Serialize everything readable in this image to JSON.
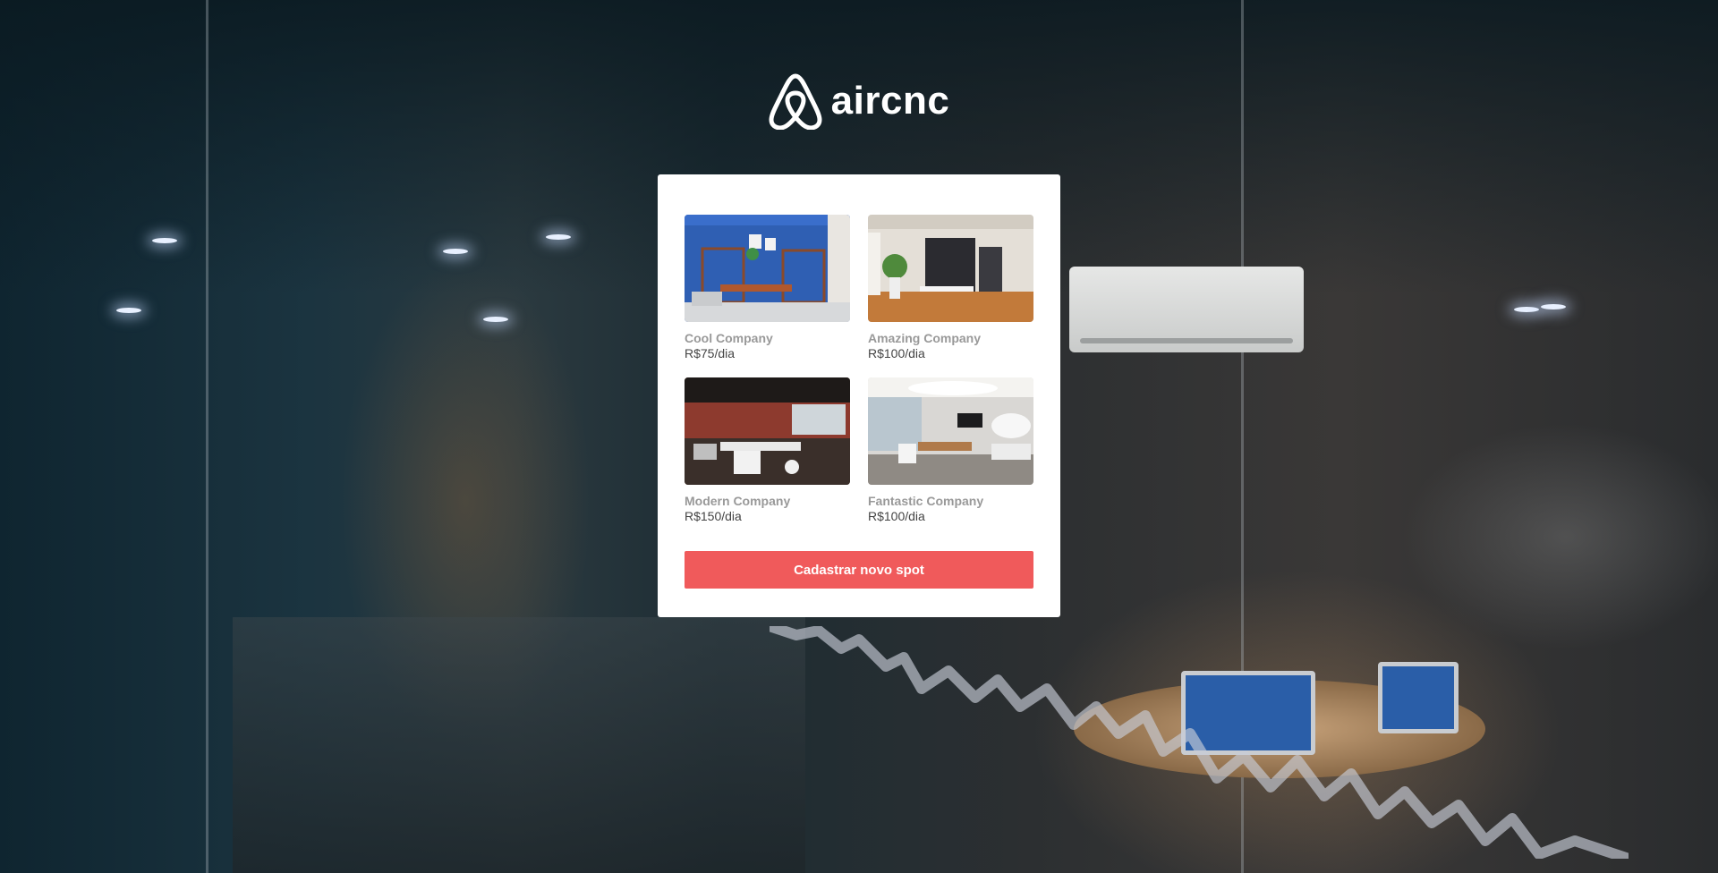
{
  "app": {
    "name": "aircnc",
    "logo_icon": "airbnb-belo-icon"
  },
  "spots": [
    {
      "company": "Cool Company",
      "price": "R$75/dia"
    },
    {
      "company": "Amazing Company",
      "price": "R$100/dia"
    },
    {
      "company": "Modern Company",
      "price": "R$150/dia"
    },
    {
      "company": "Fantastic Company",
      "price": "R$100/dia"
    }
  ],
  "cta": {
    "label": "Cadastrar novo spot"
  },
  "colors": {
    "accent": "#f05a5b",
    "card": "#ffffff",
    "company_text": "#999999",
    "price_text": "#444444"
  }
}
